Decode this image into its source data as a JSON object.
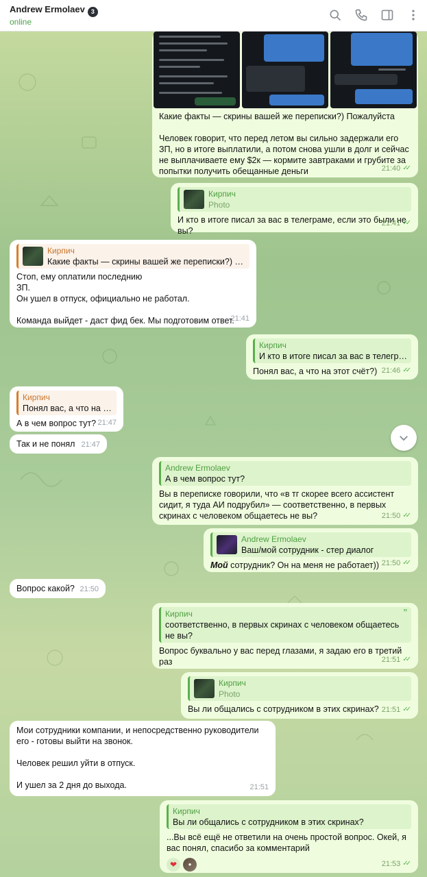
{
  "header": {
    "name": "Andrew Ermolaev",
    "badge": "3",
    "status": "online"
  },
  "colors": {
    "accent": "#4aa248",
    "outgoing": "#effdde",
    "incoming": "#ffffff",
    "reply_green": "#5cae4e",
    "reply_orange": "#d5802d"
  },
  "icons": [
    "search-icon",
    "phone-icon",
    "sidebar-toggle-icon",
    "more-vertical-icon",
    "chevron-down-icon",
    "double-check-icon",
    "heart-icon"
  ],
  "messages": [
    {
      "id": "m1",
      "text": "Какие факты — скрины вашей же переписки?) Пожалуйста\n\nЧеловек говорит, что перед летом вы сильно задержали его ЗП, но в итоге выплатили, а потом снова ушли в долг и сейчас не выплачиваете ему $2к — кормите завтраками и грубите за попытки получить обещанные деньги",
      "time": "21:40"
    },
    {
      "id": "m2",
      "reply_name": "Кирпич",
      "reply_text": "Photo",
      "text": "И кто в итоге писал за вас в телеграме, если это были не вы?",
      "time": "21:41"
    },
    {
      "id": "m3",
      "reply_name": "Кирпич",
      "reply_text": "Какие факты — скрины вашей же переписки?) Пож...",
      "text": "Стоп, ему оплатили последнию\nЗП.\nОн ушел в отпуск, официально не работал.\n\nКоманда выйдет - даст фид бек. Мы подготовим ответ.",
      "time": "21:41"
    },
    {
      "id": "m4",
      "reply_name": "Кирпич",
      "reply_text": "И кто в итоге писал за вас в телегра...",
      "text": "Понял вас, а что на этот счёт?)",
      "time": "21:46"
    },
    {
      "id": "m5",
      "reply_name": "Кирпич",
      "reply_text": "Понял вас, а что на эт...",
      "text": "А в чем вопрос тут?",
      "time": "21:47"
    },
    {
      "id": "m6",
      "text": "Так и не понял",
      "time": "21:47"
    },
    {
      "id": "m7",
      "reply_name": "Andrew Ermolaev",
      "reply_text": "А в чем вопрос тут?",
      "text": "Вы в переписке говорили, что «в тг скорее всего ассистент сидит, я туда АИ подрубил» — соответственно, в первых скринах с человеком общаетесь не вы?",
      "time": "21:50"
    },
    {
      "id": "m8",
      "reply_name": "Andrew Ermolaev",
      "reply_text": "Ваш/мой сотрудник - стер диалог",
      "text_bold": "Мой",
      "text": " сотрудник? Он на меня не работает))",
      "time": "21:50"
    },
    {
      "id": "m9",
      "text": "Вопрос какой?",
      "time": "21:50"
    },
    {
      "id": "m10",
      "reply_name": "Кирпич",
      "reply_text": "соответственно, в первых скринах с человеком общаетесь не вы?",
      "text": "Вопрос буквально у вас перед глазами, я задаю его в третий раз",
      "time": "21:51"
    },
    {
      "id": "m11",
      "reply_name": "Кирпич",
      "reply_text": "Photo",
      "text": "Вы ли общались с сотрудником в этих скринах?",
      "time": "21:51"
    },
    {
      "id": "m12",
      "text": "Мои сотрудники компании, и непосредственно руководители его - готовы выйти на звонок.\n\nЧеловек решил уйти в отпуск.\n\nИ ушел за 2 дня до выхода.",
      "time": "21:51"
    },
    {
      "id": "m13",
      "reply_name": "Кирпич",
      "reply_text": "Вы ли общались с сотрудником в этих скринах?",
      "text": "...Вы всё ещё не ответили на очень простой вопрос. Окей, я вас понял, спасибо за комментарий",
      "time": "21:53"
    }
  ]
}
